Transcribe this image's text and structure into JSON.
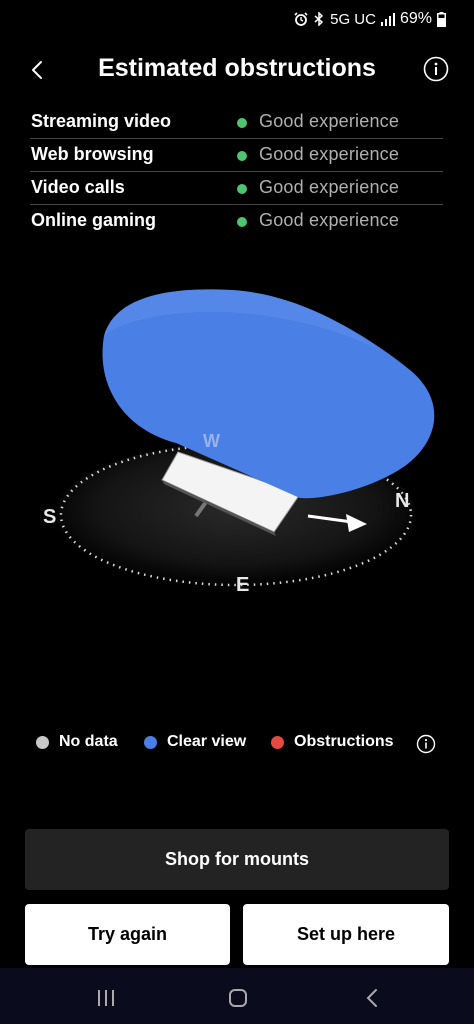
{
  "status_bar": {
    "network": "5G UC",
    "battery": "69%"
  },
  "header": {
    "title": "Estimated obstructions"
  },
  "quality": [
    {
      "name": "Streaming video",
      "status": "Good experience"
    },
    {
      "name": "Web browsing",
      "status": "Good experience"
    },
    {
      "name": "Video calls",
      "status": "Good experience"
    },
    {
      "name": "Online gaming",
      "status": "Good experience"
    }
  ],
  "compass": {
    "w": "W",
    "n": "N",
    "s": "S",
    "e": "E"
  },
  "legend": [
    {
      "label": "No data",
      "color": "#c8c8c8"
    },
    {
      "label": "Clear view",
      "color": "#4a7fe6"
    },
    {
      "label": "Obstructions",
      "color": "#e5493f"
    }
  ],
  "buttons": {
    "shop": "Shop for mounts",
    "try_again": "Try again",
    "set_up": "Set up here"
  },
  "colors": {
    "good": "#4fc46e",
    "sky": "#4a7fe6"
  }
}
